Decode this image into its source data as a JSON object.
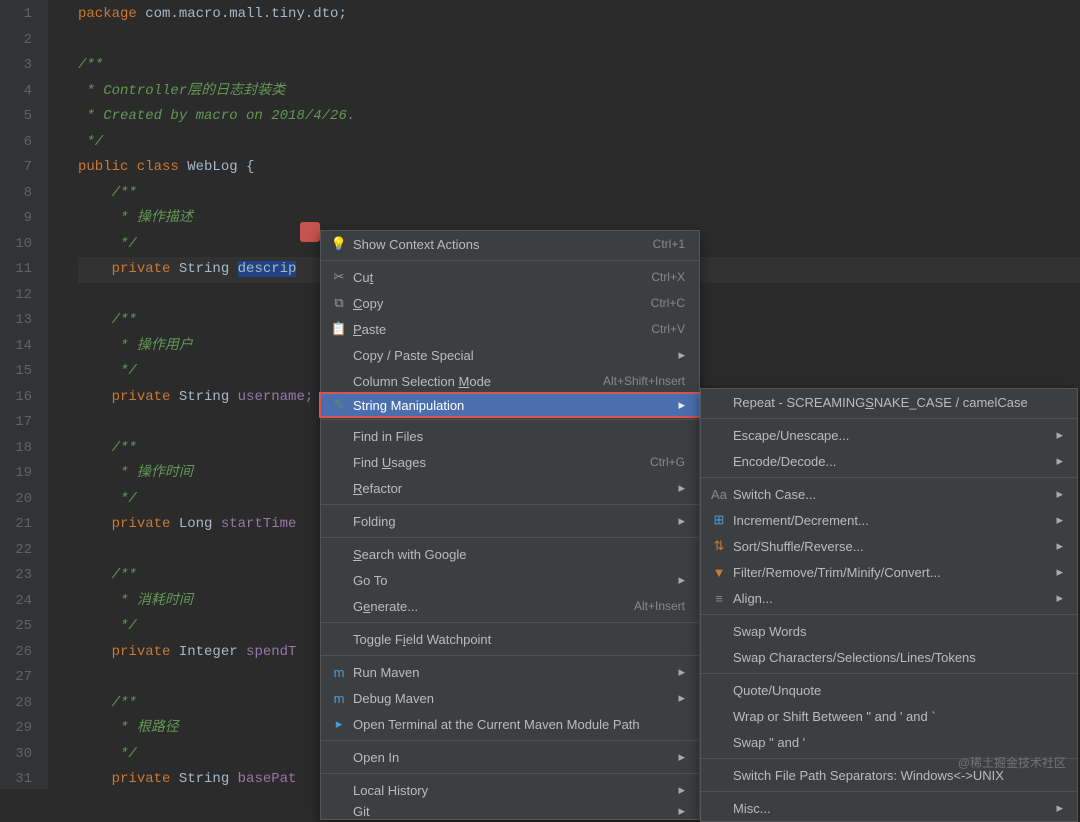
{
  "gutter": [
    "1",
    "2",
    "3",
    "4",
    "5",
    "6",
    "7",
    "8",
    "9",
    "10",
    "11",
    "12",
    "13",
    "14",
    "15",
    "16",
    "17",
    "18",
    "19",
    "20",
    "21",
    "22",
    "23",
    "24",
    "25",
    "26",
    "27",
    "28",
    "29",
    "30",
    "31"
  ],
  "code": {
    "l1": {
      "kw": "package",
      "pkg": " com.macro.mall.tiny.dto;"
    },
    "l3": "/**",
    "l4": " * Controller层的日志封装类",
    "l5": " * Created by macro on 2018/4/26.",
    "l6": " */",
    "l7": {
      "kw": "public class",
      "type": " WebLog ",
      "brace": "{"
    },
    "l8": "/**",
    "l9": " * 操作描述",
    "l10": " */",
    "l11": {
      "kw": "private",
      "type": " String ",
      "fld": "descrip"
    },
    "l13": "/**",
    "l14": " * 操作用户",
    "l15": " */",
    "l16": {
      "kw": "private",
      "type": " String ",
      "fld": "username;"
    },
    "l18": "/**",
    "l19": " * 操作时间",
    "l20": " */",
    "l21": {
      "kw": "private",
      "type": " Long ",
      "fld": "startTime"
    },
    "l23": "/**",
    "l24": " * 消耗时间",
    "l25": " */",
    "l26": {
      "kw": "private",
      "type": " Integer ",
      "fld": "spendT"
    },
    "l28": "/**",
    "l29": " * 根路径",
    "l30": " */",
    "l31": {
      "kw": "private",
      "type": " String ",
      "fld": "basePat"
    }
  },
  "menu1": {
    "showCtx": {
      "label": "Show Context Actions",
      "sc": "Ctrl+1"
    },
    "cut": {
      "label": "Cut",
      "u": "t",
      "sc": "Ctrl+X"
    },
    "copy": {
      "label": "Copy",
      "u": "C",
      "sc": "Ctrl+C"
    },
    "paste": {
      "label": "Paste",
      "u": "P",
      "sc": "Ctrl+V"
    },
    "cps": {
      "label": "Copy / Paste Special"
    },
    "csm": {
      "pre": "Column Selection ",
      "u": "M",
      "suf": "ode",
      "sc": "Alt+Shift+Insert"
    },
    "sm": {
      "label": "String Manipulation"
    },
    "fif": {
      "label": "Find in Files"
    },
    "fu": {
      "pre": "Find ",
      "u": "U",
      "suf": "sages",
      "sc": "Ctrl+G"
    },
    "ref": {
      "u": "R",
      "suf": "efactor"
    },
    "fold": {
      "pre": "Foldin",
      "u": "g"
    },
    "swg": {
      "u": "S",
      "suf": "earch with Google"
    },
    "goto": {
      "label": "Go To"
    },
    "gen": {
      "pre": "G",
      "u": "e",
      "suf": "nerate...",
      "sc": "Alt+Insert"
    },
    "tfw": {
      "pre": "Toggle F",
      "u": "i",
      "suf": "eld Watchpoint"
    },
    "rm": {
      "label": "Run Maven"
    },
    "dm": {
      "label": "Debug Maven"
    },
    "ot": {
      "label": "Open Terminal at the Current Maven Module Path"
    },
    "oi": {
      "label": "Open In"
    },
    "lh": {
      "label": "Local History"
    },
    "git": {
      "label": "Git"
    }
  },
  "menu2": {
    "repeat": {
      "pre": "Repeat - SCREAMING",
      "u": "S",
      "suf": "NAKE_CASE / camelCase"
    },
    "esc": {
      "label": "Escape/Unescape..."
    },
    "enc": {
      "label": "Encode/Decode..."
    },
    "swc": {
      "label": "Switch Case..."
    },
    "inc": {
      "label": "Increment/Decrement..."
    },
    "sort": {
      "label": "Sort/Shuffle/Reverse..."
    },
    "filt": {
      "label": "Filter/Remove/Trim/Minify/Convert..."
    },
    "align": {
      "label": "Align..."
    },
    "sw": {
      "label": "Swap Words"
    },
    "sc": {
      "label": "Swap Characters/Selections/Lines/Tokens"
    },
    "qu": {
      "label": "Quote/Unquote"
    },
    "wrap": {
      "label": "Wrap or Shift Between \" and ' and `"
    },
    "swap2": {
      "label": "Swap \" and '"
    },
    "sfps": {
      "label": "Switch File Path Separators: Windows<->UNIX"
    },
    "misc": {
      "label": "Misc..."
    }
  },
  "watermark": "@稀土掘金技术社区"
}
